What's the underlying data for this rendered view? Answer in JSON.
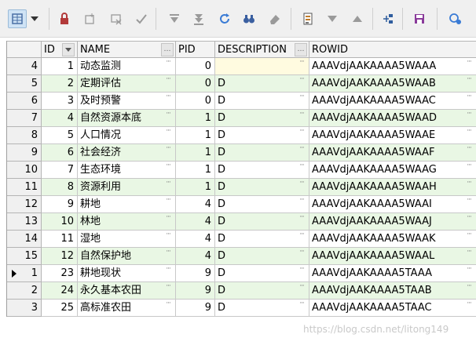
{
  "toolbar": {
    "buttons": [
      {
        "name": "grid-view-icon",
        "color": "#4a6fa5"
      },
      {
        "name": "dropdown-arrow-icon",
        "color": "#333333"
      },
      {
        "name": "lock-icon",
        "color": "#b23a3a"
      },
      {
        "name": "add-record-icon",
        "color": "#9a9a9a"
      },
      {
        "name": "delete-record-icon",
        "color": "#9a9a9a"
      },
      {
        "name": "post-check-icon",
        "color": "#9a9a9a"
      },
      {
        "name": "filter-down-icon",
        "color": "#9a9a9a"
      },
      {
        "name": "filter-all-icon",
        "color": "#9a9a9a"
      },
      {
        "name": "refresh-icon",
        "color": "#3a7bd5"
      },
      {
        "name": "find-binoculars-icon",
        "color": "#3a5fa0"
      },
      {
        "name": "clear-eraser-icon",
        "color": "#9a9a9a"
      },
      {
        "name": "export-icon",
        "color": "#c07b2a"
      },
      {
        "name": "move-down-icon",
        "color": "#9a9a9a"
      },
      {
        "name": "move-up-icon",
        "color": "#9a9a9a"
      },
      {
        "name": "tree-connect-icon",
        "color": "#2f5d9e"
      },
      {
        "name": "save-disk-icon",
        "color": "#8a3a9a"
      },
      {
        "name": "query-icon",
        "color": "#3a7bd5"
      }
    ]
  },
  "columns": [
    "ID",
    "NAME",
    "PID",
    "DESCRIPTION",
    "ROWID"
  ],
  "rows": [
    {
      "rownum": "4",
      "id": "1",
      "name": "动态监测",
      "pid": "0",
      "description": "",
      "rowid": "AAAVdjAAKAAAA5WAAA"
    },
    {
      "rownum": "5",
      "id": "2",
      "name": "定期评估",
      "pid": "0",
      "description": "D",
      "rowid": "AAAVdjAAKAAAA5WAAB"
    },
    {
      "rownum": "6",
      "id": "3",
      "name": "及时预警",
      "pid": "0",
      "description": "D",
      "rowid": "AAAVdjAAKAAAA5WAAC"
    },
    {
      "rownum": "7",
      "id": "4",
      "name": "自然资源本底",
      "pid": "1",
      "description": "D",
      "rowid": "AAAVdjAAKAAAA5WAAD"
    },
    {
      "rownum": "8",
      "id": "5",
      "name": "人口情况",
      "pid": "1",
      "description": "D",
      "rowid": "AAAVdjAAKAAAA5WAAE"
    },
    {
      "rownum": "9",
      "id": "6",
      "name": "社会经济",
      "pid": "1",
      "description": "D",
      "rowid": "AAAVdjAAKAAAA5WAAF"
    },
    {
      "rownum": "10",
      "id": "7",
      "name": "生态环境",
      "pid": "1",
      "description": "D",
      "rowid": "AAAVdjAAKAAAA5WAAG"
    },
    {
      "rownum": "11",
      "id": "8",
      "name": "资源利用",
      "pid": "1",
      "description": "D",
      "rowid": "AAAVdjAAKAAAA5WAAH"
    },
    {
      "rownum": "12",
      "id": "9",
      "name": "耕地",
      "pid": "4",
      "description": "D",
      "rowid": "AAAVdjAAKAAAA5WAAI"
    },
    {
      "rownum": "13",
      "id": "10",
      "name": "林地",
      "pid": "4",
      "description": "D",
      "rowid": "AAAVdjAAKAAAA5WAAJ"
    },
    {
      "rownum": "14",
      "id": "11",
      "name": "湿地",
      "pid": "4",
      "description": "D",
      "rowid": "AAAVdjAAKAAAA5WAAK"
    },
    {
      "rownum": "15",
      "id": "12",
      "name": "自然保护地",
      "pid": "4",
      "description": "D",
      "rowid": "AAAVdjAAKAAAA5WAAL"
    },
    {
      "rownum": "1",
      "id": "23",
      "name": "耕地现状",
      "pid": "9",
      "description": "D",
      "rowid": "AAAVdjAAKAAAA5TAAA"
    },
    {
      "rownum": "2",
      "id": "24",
      "name": "永久基本农田",
      "pid": "9",
      "description": "D",
      "rowid": "AAAVdjAAKAAAA5TAAB"
    },
    {
      "rownum": "3",
      "id": "25",
      "name": "高标准农田",
      "pid": "9",
      "description": "D",
      "rowid": "AAAVdjAAKAAAA5TAAC"
    }
  ],
  "current_row_index": 12,
  "colors": {
    "alt_row": "#e9f7e4",
    "active_cell": "#fffbe0"
  },
  "watermark": "https://blog.csdn.net/litong149"
}
